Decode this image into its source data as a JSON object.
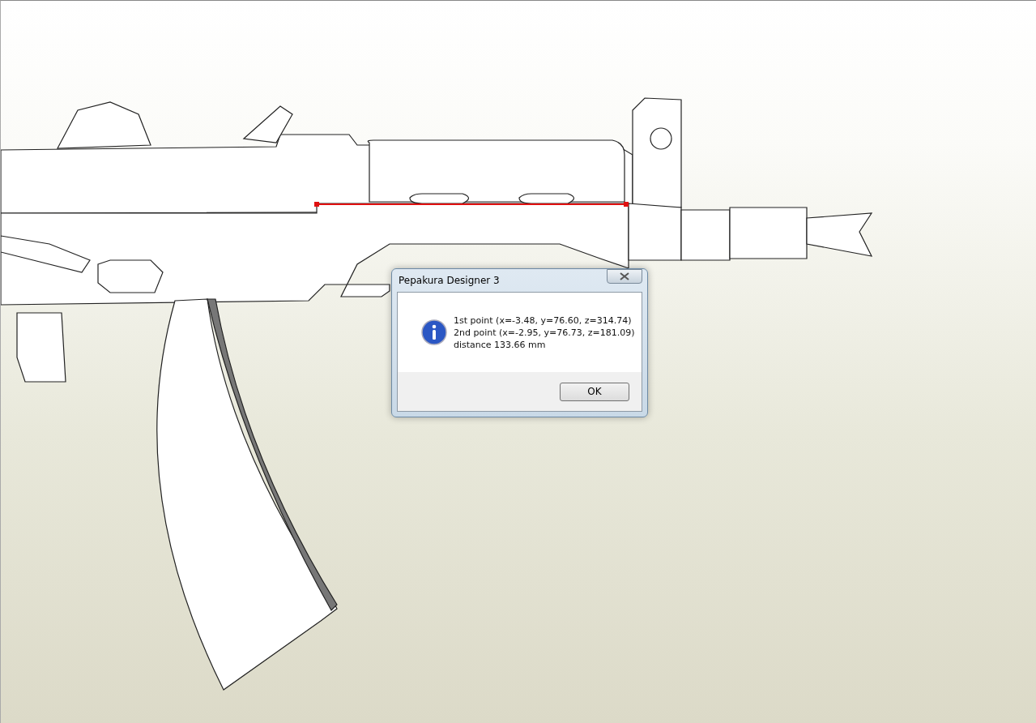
{
  "dialog": {
    "title": "Pepakura Designer 3",
    "message": [
      "1st point (x=-3.48, y=76.60, z=314.74)",
      "2nd point (x=-2.95, y=76.73, z=181.09)",
      "distance 133.66 mm"
    ],
    "buttons": [
      "OK"
    ]
  }
}
